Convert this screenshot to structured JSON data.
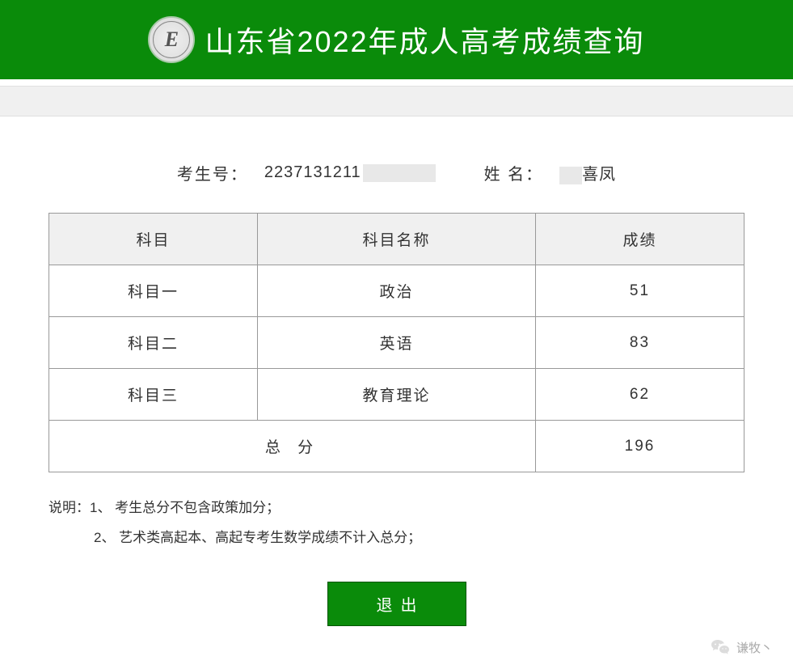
{
  "header": {
    "title": "山东省2022年成人高考成绩查询",
    "logo_letter": "E"
  },
  "student": {
    "id_label": "考生号：",
    "id_visible": "2237131211",
    "name_label": "姓 名：",
    "name_visible": "喜凤"
  },
  "table": {
    "headers": {
      "subject": "科目",
      "subject_name": "科目名称",
      "score": "成绩"
    },
    "rows": [
      {
        "subject": "科目一",
        "name": "政治",
        "score": "51"
      },
      {
        "subject": "科目二",
        "name": "英语",
        "score": "83"
      },
      {
        "subject": "科目三",
        "name": "教育理论",
        "score": "62"
      }
    ],
    "total": {
      "label": "总 分",
      "score": "196"
    }
  },
  "notes": {
    "line1": "说明：1、 考生总分不包含政策加分；",
    "line2": "2、 艺术类高起本、高起专考生数学成绩不计入总分；"
  },
  "buttons": {
    "exit": "退出"
  },
  "watermark": {
    "text": "谦牧丶"
  }
}
